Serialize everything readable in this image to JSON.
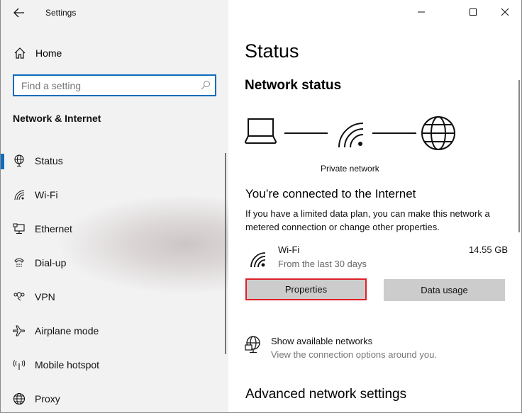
{
  "window": {
    "app_title": "Settings",
    "controls": {
      "minimize": "minimize",
      "maximize": "maximize",
      "close": "close"
    }
  },
  "sidebar": {
    "back_icon": "arrow-left-icon",
    "home": {
      "label": "Home",
      "icon": "home-icon"
    },
    "search": {
      "placeholder": "Find a setting",
      "value": "",
      "icon": "search-icon"
    },
    "section_title": "Network & Internet",
    "items": [
      {
        "label": "Status",
        "icon": "network-status-icon",
        "selected": true
      },
      {
        "label": "Wi-Fi",
        "icon": "wifi-icon",
        "selected": false
      },
      {
        "label": "Ethernet",
        "icon": "ethernet-icon",
        "selected": false
      },
      {
        "label": "Dial-up",
        "icon": "dialup-icon",
        "selected": false
      },
      {
        "label": "VPN",
        "icon": "vpn-icon",
        "selected": false
      },
      {
        "label": "Airplane mode",
        "icon": "airplane-icon",
        "selected": false
      },
      {
        "label": "Mobile hotspot",
        "icon": "hotspot-icon",
        "selected": false
      },
      {
        "label": "Proxy",
        "icon": "globe-icon",
        "selected": false
      }
    ],
    "accent_color": "#0f6cbd"
  },
  "main": {
    "page_title": "Status",
    "network_status_heading": "Network status",
    "diagram_label": "Private network",
    "connected_heading": "You’re connected to the Internet",
    "description": "If you have a limited data plan, you can make this network a metered connection or change other properties.",
    "description_line1": "If you have a limited data plan, you can make this network a",
    "description_line2": "metered connection or change other properties.",
    "connection": {
      "name": "Wi-Fi",
      "subtitle": "From the last 30 days",
      "data_used": "14.55 GB"
    },
    "buttons": {
      "properties": "Properties",
      "data_usage": "Data usage"
    },
    "highlight_color": "#e0202a",
    "show_networks": {
      "title": "Show available networks",
      "subtitle": "View the connection options around you."
    },
    "advanced_heading": "Advanced network settings"
  }
}
